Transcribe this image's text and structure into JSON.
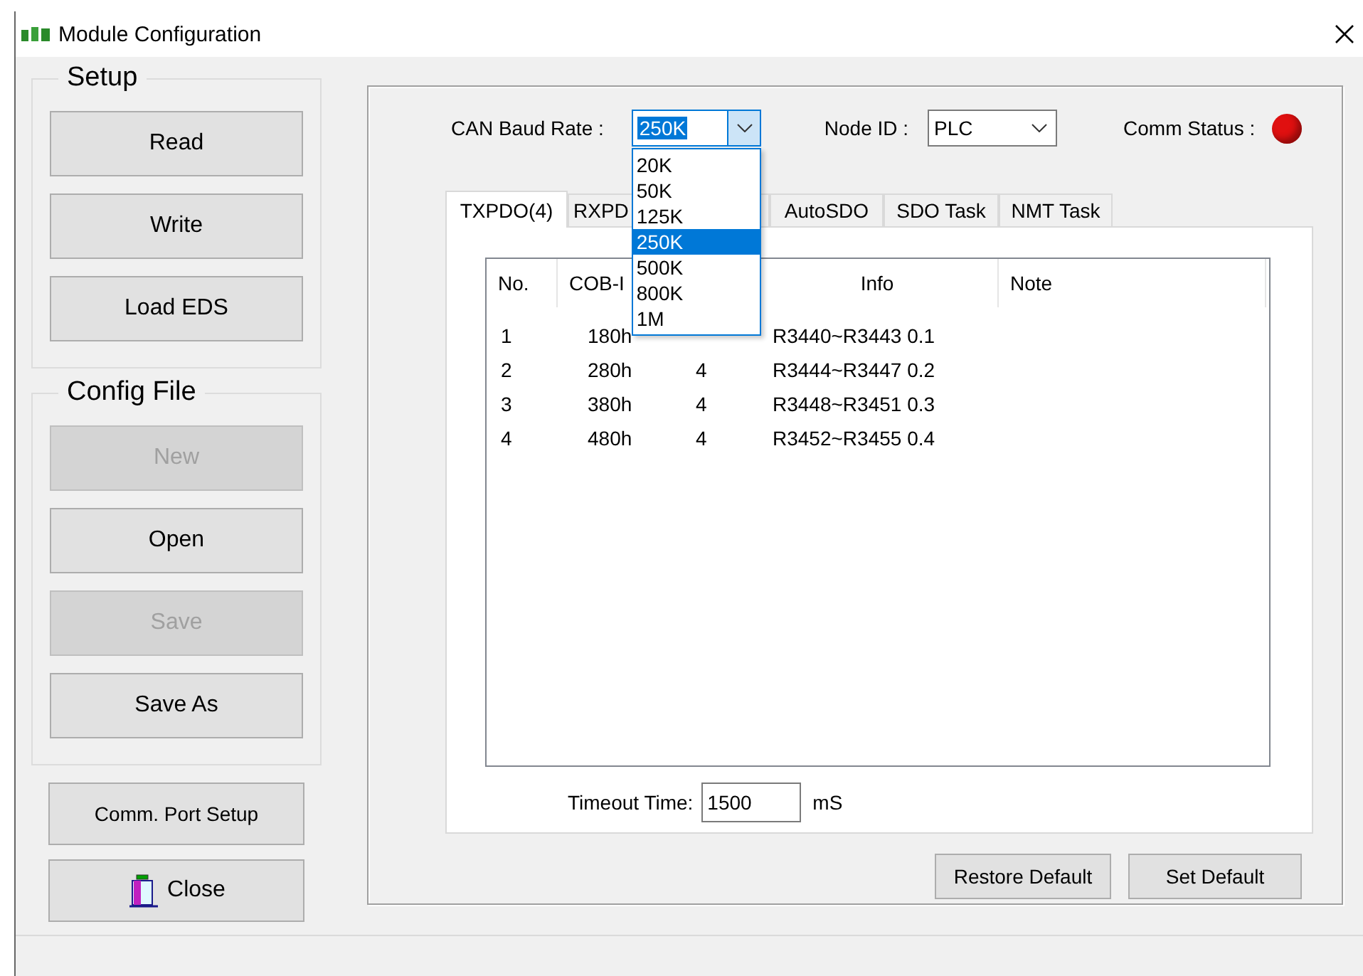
{
  "window": {
    "title": "Module Configuration"
  },
  "setup": {
    "title": "Setup",
    "buttons": [
      {
        "label": "Read",
        "disabled": false
      },
      {
        "label": "Write",
        "disabled": false
      },
      {
        "label": "Load EDS",
        "disabled": false
      }
    ]
  },
  "config_file": {
    "title": "Config File",
    "buttons": [
      {
        "label": "New",
        "disabled": true
      },
      {
        "label": "Open",
        "disabled": false
      },
      {
        "label": "Save",
        "disabled": true
      },
      {
        "label": "Save As",
        "disabled": false
      }
    ]
  },
  "bottom_buttons": [
    {
      "label": "Comm. Port Setup",
      "kind": "plain"
    },
    {
      "label": "Close",
      "kind": "exit"
    }
  ],
  "baud_rate": {
    "label": "CAN Baud Rate :",
    "value": "250K",
    "expanded": true,
    "options": [
      {
        "label": "20K",
        "selected": false
      },
      {
        "label": "50K",
        "selected": false
      },
      {
        "label": "125K",
        "selected": false
      },
      {
        "label": "250K",
        "selected": true
      },
      {
        "label": "500K",
        "selected": false
      },
      {
        "label": "800K",
        "selected": false
      },
      {
        "label": "1M",
        "selected": false
      }
    ]
  },
  "node_id": {
    "label": "Node ID :",
    "value": "PLC"
  },
  "comm_status": {
    "label": "Comm Status :",
    "connected": false
  },
  "tabs": [
    {
      "label": "TXPDO(4)",
      "selected": true
    },
    {
      "label": "RXPD",
      "selected": false
    },
    {
      "label": "AutoSDO",
      "selected": false
    },
    {
      "label": "SDO Task",
      "selected": false
    },
    {
      "label": "NMT Task",
      "selected": false
    }
  ],
  "table": {
    "columns": [
      {
        "label": "No."
      },
      {
        "label": "COB-I"
      },
      {},
      {
        "label": "Info"
      },
      {
        "label": "Note"
      }
    ],
    "rows": [
      {
        "cells": [
          "1",
          "180h",
          null,
          "R3440~R3443 0.1"
        ]
      },
      {
        "cells": [
          "2",
          "280h",
          "4",
          "R3444~R3447 0.2"
        ]
      },
      {
        "cells": [
          "3",
          "380h",
          "4",
          "R3448~R3451 0.3"
        ]
      },
      {
        "cells": [
          "4",
          "480h",
          "4",
          "R3452~R3455 0.4"
        ]
      }
    ]
  },
  "timeout": {
    "label": "Timeout Time:",
    "value": "1500",
    "unit": "mS"
  },
  "footer_buttons": [
    "Restore Default",
    "Set Default"
  ]
}
